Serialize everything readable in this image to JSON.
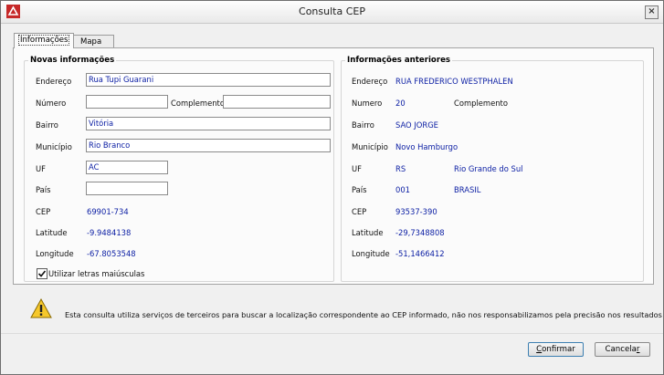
{
  "window": {
    "title": "Consulta CEP",
    "close": "×"
  },
  "tabs": [
    {
      "label": "Informações"
    },
    {
      "label": "Mapa"
    }
  ],
  "novas": {
    "title": "Novas informações",
    "labels": {
      "endereco": "Endereço",
      "numero": "Número",
      "complemento": "Complemento",
      "bairro": "Bairro",
      "municipio": "Município",
      "uf": "UF",
      "pais": "País",
      "cep": "CEP",
      "latitude": "Latitude",
      "longitude": "Longitude"
    },
    "values": {
      "endereco": "Rua Tupi Guarani",
      "numero": "",
      "complemento": "",
      "bairro": "Vitória",
      "municipio": "Rio Branco",
      "uf": "AC",
      "pais": "",
      "cep": "69901-734",
      "latitude": "-9.9484138",
      "longitude": "-67.8053548"
    },
    "checkbox_label": "Utilizar letras maiúsculas",
    "checkbox_checked": true
  },
  "anteriores": {
    "title": "Informações anteriores",
    "labels": {
      "endereco": "Endereço",
      "numero": "Numero",
      "complemento": "Complemento",
      "bairro": "Bairro",
      "municipio": "Município",
      "uf": "UF",
      "pais": "País",
      "cep": "CEP",
      "latitude": "Latitude",
      "longitude": "Longitude"
    },
    "values": {
      "endereco": "RUA FREDERICO WESTPHALEN",
      "numero": "20",
      "bairro": "SAO JORGE",
      "municipio": "Novo Hamburgo",
      "uf": "RS",
      "uf_nome": "Rio Grande do Sul",
      "pais": "001",
      "pais_nome": "BRASIL",
      "cep": "93537-390",
      "latitude": "-29,7348808",
      "longitude": "-51,1466412"
    }
  },
  "notice": "Esta consulta utiliza serviços de terceiros para buscar a localização correspondente ao CEP informado, não nos responsabilizamos pela precisão nos resultados obtidos.",
  "buttons": {
    "confirm": {
      "label": "Confirmar",
      "mnemonic": "C",
      "rest": "onfirmar"
    },
    "cancel": {
      "label": "Cancelar",
      "mnemonic": "r",
      "rest": "Cancela"
    }
  },
  "colors": {
    "value": "#0a1da3",
    "accent": "#3c7fb1"
  },
  "icons": {
    "app": "app-icon",
    "warning": "warning-icon",
    "check": "check-icon",
    "close": "close-icon"
  }
}
